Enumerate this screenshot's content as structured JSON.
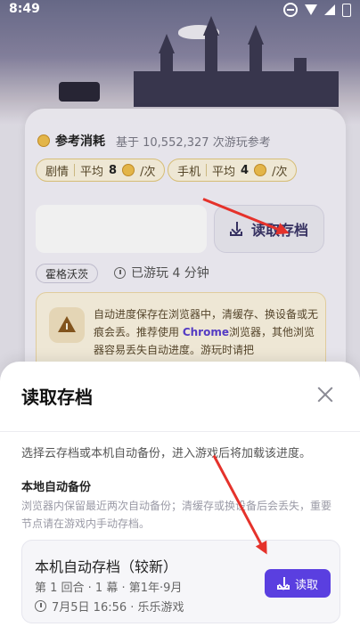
{
  "status_bar": {
    "time": "8:49"
  },
  "card": {
    "cost_title": "参考消耗",
    "cost_sub": "基于 10,552,327 次游玩参考",
    "pills": [
      {
        "label": "剧情",
        "avg_label": "平均",
        "value": "8",
        "unit": "/次"
      },
      {
        "label": "手机",
        "avg_label": "平均",
        "value": "4",
        "unit": "/次"
      }
    ],
    "load_button_label": "读取存档",
    "tag": "霍格沃茨",
    "played": "已游玩 4 分钟",
    "warning": {
      "part1": "自动进度保存在浏览器中，清缓存、换设备或无痕会丢。推荐使用 ",
      "browser": "Chrome",
      "part2": "浏览器，其他浏览器容易丢失自动进度。游玩时请把"
    }
  },
  "sheet": {
    "title": "读取存档",
    "description": "选择云存档或本机自动备份，进入游戏后将加载该进度。",
    "section_title": "本地自动备份",
    "section_desc": "浏览器内保留最近两次自动备份；清缓存或换设备后会丢失，重要节点请在游戏内手动存档。",
    "save": {
      "title": "本机自动存档（较新）",
      "meta": "第 1 回合 · 1 幕 · 第1年·9月",
      "time": "7月5日 16:56 · 乐乐游戏",
      "read_label": "读取"
    }
  },
  "colors": {
    "accent": "#5a3fe0",
    "annotation": "#e5322b"
  }
}
